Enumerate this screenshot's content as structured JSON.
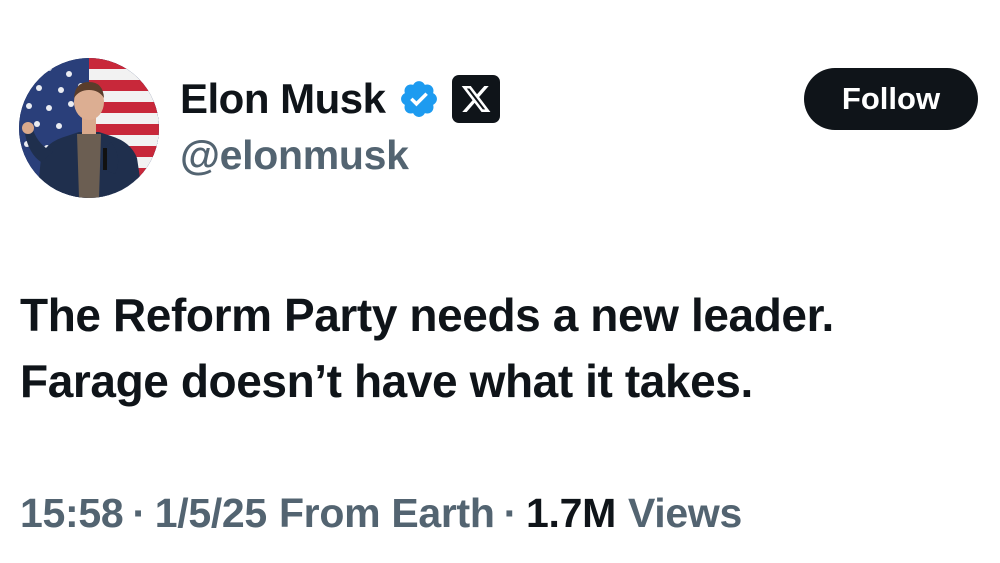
{
  "author": {
    "display_name": "Elon Musk",
    "handle": "@elonmusk",
    "verified_icon": "verified-badge-icon",
    "affiliate_icon": "x-logo-icon",
    "avatar": "profile-photo-avatar"
  },
  "follow_button": {
    "label": "Follow"
  },
  "tweet": {
    "text_lines": [
      "The Reform Party needs a new leader.",
      "Farage doesn’t have what it takes."
    ]
  },
  "meta": {
    "time": "15:58",
    "separator": "·",
    "date": "1/5/25",
    "source": "From Earth",
    "views_count": "1.7M",
    "views_label": "Views"
  },
  "colors": {
    "text_primary": "#0f1419",
    "text_secondary": "#536471",
    "verified_blue": "#1d9bf0",
    "button_bg": "#0f1419",
    "button_text": "#ffffff"
  }
}
